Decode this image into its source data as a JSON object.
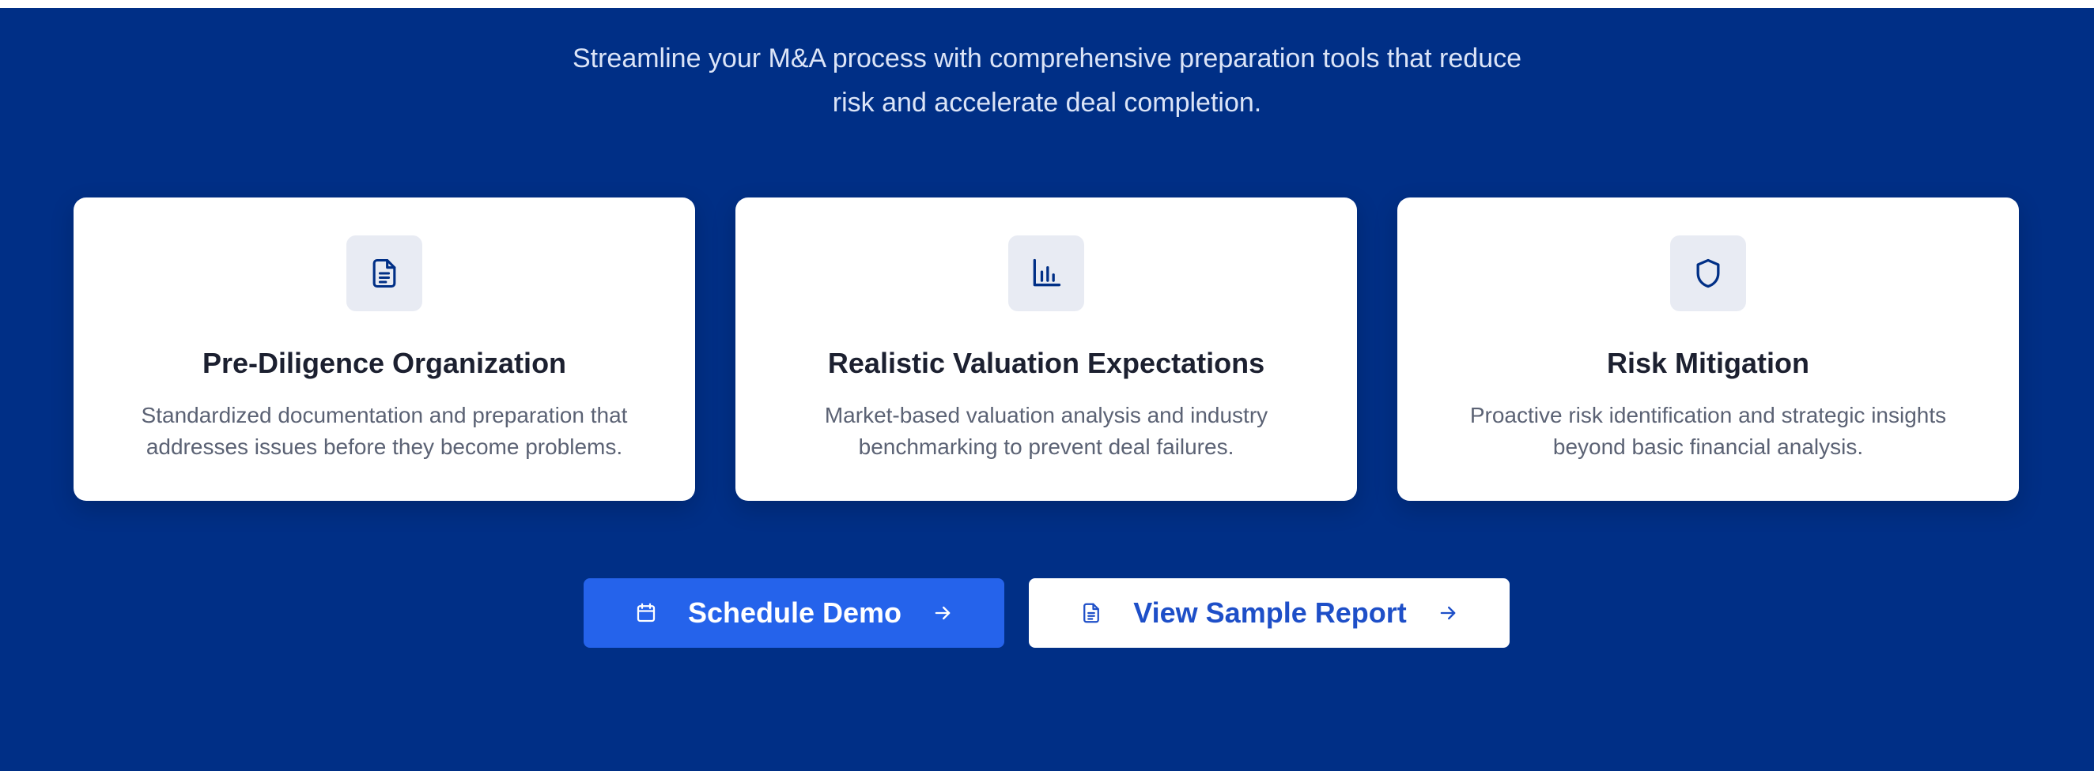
{
  "hero": {
    "subtitle_line1": "Streamline your M&A process with comprehensive preparation tools that reduce",
    "subtitle_line2": "risk and accelerate deal completion."
  },
  "features": [
    {
      "icon": "document-icon",
      "title": "Pre-Diligence Organization",
      "desc_line1": "Standardized documentation and preparation that",
      "desc_line2": "addresses issues before they become problems."
    },
    {
      "icon": "bar-chart-icon",
      "title": "Realistic Valuation Expectations",
      "desc_line1": "Market-based valuation analysis and industry",
      "desc_line2": "benchmarking to prevent deal failures."
    },
    {
      "icon": "shield-icon",
      "title": "Risk Mitigation",
      "desc_line1": "Proactive risk identification and strategic insights",
      "desc_line2": "beyond basic financial analysis."
    }
  ],
  "actions": {
    "primary": {
      "label": "Schedule Demo",
      "icon": "calendar-icon",
      "trailing_icon": "arrow-right-icon"
    },
    "secondary": {
      "label": "View Sample Report",
      "icon": "document-icon",
      "trailing_icon": "arrow-right-icon"
    }
  },
  "colors": {
    "background": "#002f86",
    "card": "#ffffff",
    "icon_tile": "#e8ebf3",
    "primary_button": "#2563eb",
    "secondary_text": "#1e4fc8"
  }
}
